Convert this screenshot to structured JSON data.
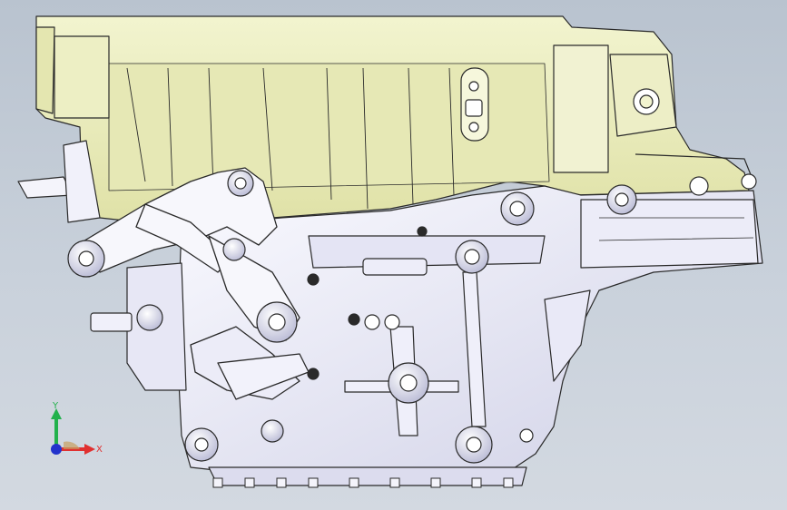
{
  "viewport": {
    "background_top": "#b9c3cf",
    "background_bottom": "#d3d9e1"
  },
  "model": {
    "housing_color": "#eef0c8",
    "housing_shade": "#d9dc9a",
    "casing_color": "#f4f4fb",
    "casing_shade": "#c8c8df",
    "edge_color": "#2a2a2a"
  },
  "triad": {
    "y_label": "Y",
    "x_label": "X",
    "y_color": "#22b14c",
    "x_color": "#e03030",
    "z_color": "#2233cc",
    "icons": [
      "axis-triad-icon"
    ]
  }
}
